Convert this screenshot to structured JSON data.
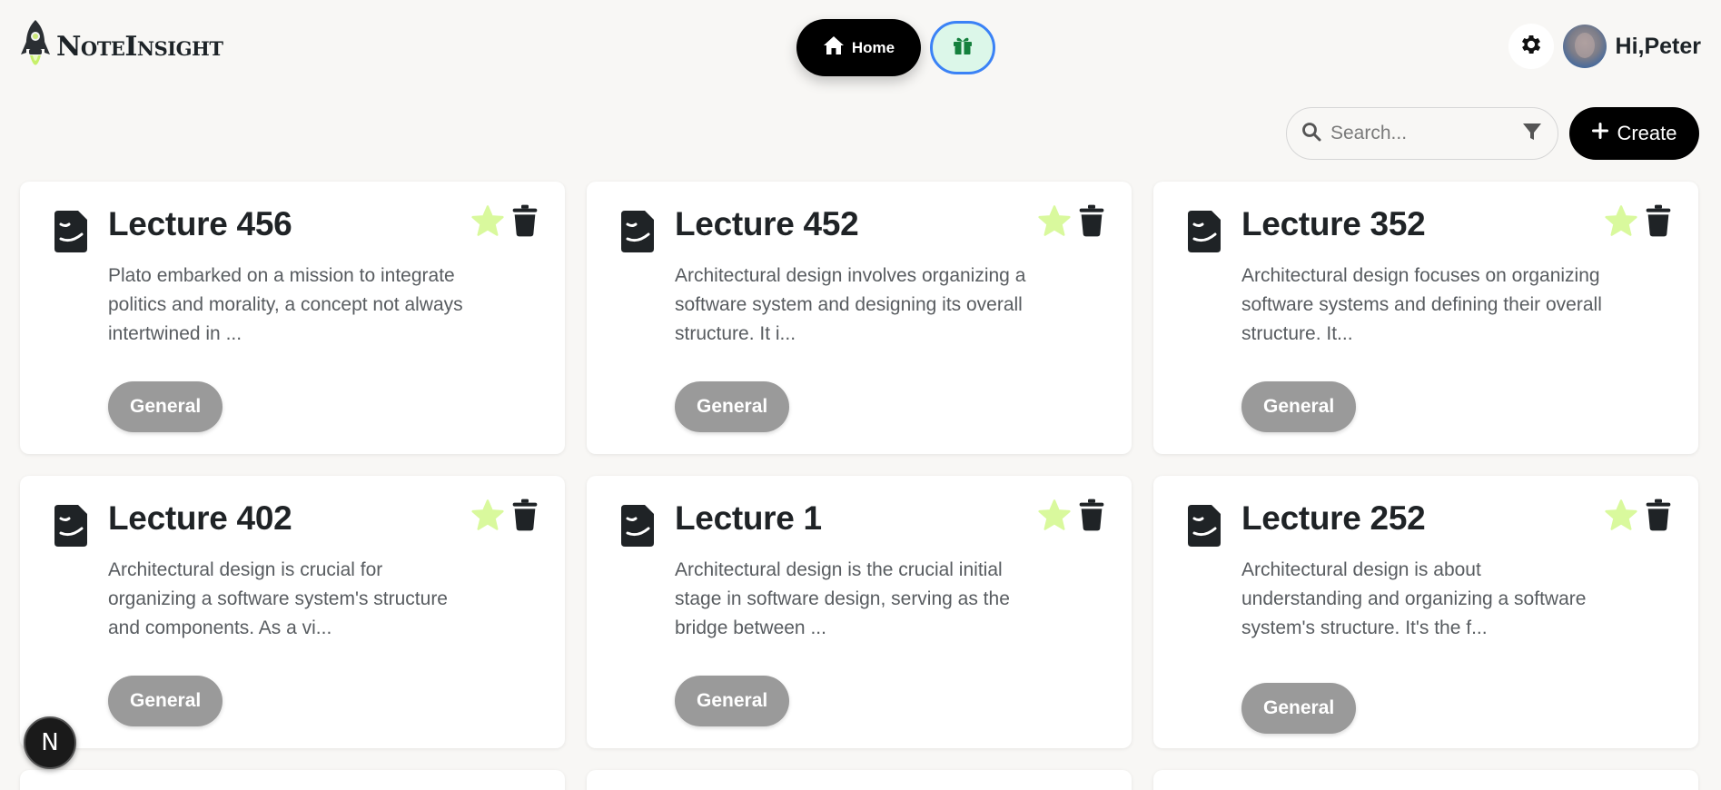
{
  "brand": {
    "name": "NoteInsight"
  },
  "nav": {
    "home_label": "Home"
  },
  "user": {
    "greeting": "Hi,Peter"
  },
  "toolbar": {
    "search_placeholder": "Search...",
    "create_label": "Create"
  },
  "notes": [
    {
      "title": "Lecture 456",
      "description": "Plato embarked on a mission to integrate politics and morality, a concept not always intertwined in ...",
      "tag": "General"
    },
    {
      "title": "Lecture 452",
      "description": "Architectural design involves organizing a software system and designing its overall structure. It i...",
      "tag": "General"
    },
    {
      "title": "Lecture 352",
      "description": "Architectural design focuses on organizing software systems and defining their overall structure. It...",
      "tag": "General"
    },
    {
      "title": "Lecture 402",
      "description": "Architectural design is crucial for organizing a software system's structure and components. As a vi...",
      "tag": "General"
    },
    {
      "title": "Lecture 1",
      "description": "Architectural design is the crucial initial stage in software design, serving as the bridge between ...",
      "tag": "General"
    },
    {
      "title": "Lecture 252",
      "description": "Architectural design is about understanding and organizing a software system's structure. It's the f...",
      "tag": "General"
    }
  ],
  "dev_badge": {
    "letter": "N"
  },
  "colors": {
    "star": "#d9f99d",
    "tag": "#9a9a9a",
    "accent": "#000000",
    "gift_bg": "#dcf7e9",
    "gift_border": "#3b82f6"
  }
}
